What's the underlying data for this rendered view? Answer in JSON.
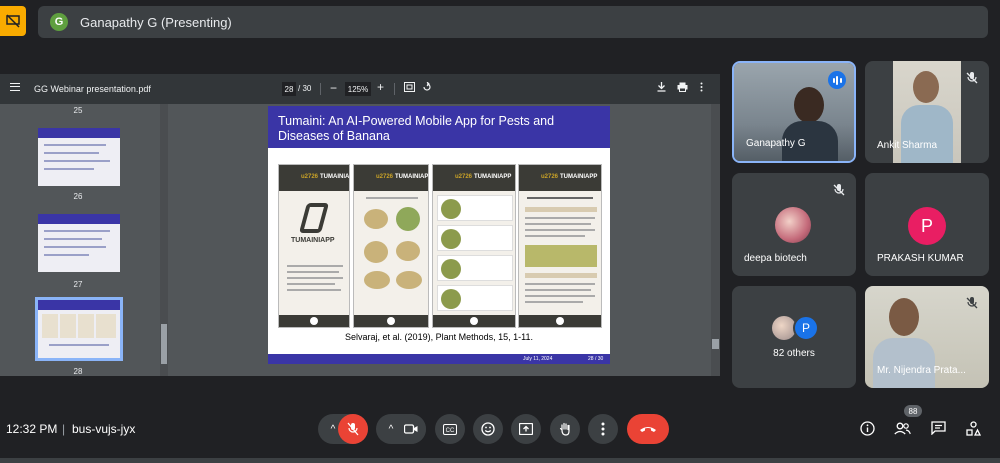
{
  "meeting": {
    "presenter_initial": "G",
    "presenter_label": "Ganapathy G (Presenting)",
    "time": "12:32 PM",
    "separator": "|",
    "code": "bus-vujs-jyx",
    "participant_count": "88"
  },
  "pdf": {
    "filename": "GG Webinar presentation.pdf",
    "current_page": "28",
    "total_pages": "/ 30",
    "zoom": "125%",
    "thumbnails": [
      "25",
      "26",
      "27",
      "28"
    ],
    "selected_thumbnail": "28"
  },
  "slide": {
    "title": "Tumaini: An AI-Powered Mobile App for Pests and Diseases of Banana",
    "citation": "Selvaraj, et al. (2019), Plant Methods, 15, 1-11.",
    "app_logo": "TUMAINIAPP",
    "footer_date": "July 11, 2024",
    "footer_page": "28 / 30"
  },
  "participants": [
    {
      "name": "Ganapathy G",
      "speaking": true,
      "muted": false
    },
    {
      "name": "Ankit Sharma",
      "muted": true
    },
    {
      "name": "deepa biotech",
      "muted": true
    },
    {
      "name": "PRAKASH KUMAR",
      "initial": "P",
      "muted": false
    },
    {
      "name": "82 others",
      "initial": "P"
    },
    {
      "name": "Mr. Nijendra Prata...",
      "muted": true
    }
  ],
  "colors": {
    "background": "#202124",
    "tile": "#3c4043",
    "accent": "#1a73e8",
    "end_call": "#ea4335",
    "slide_header": "#3a35a6",
    "present_badge": "#f9ab00",
    "avatar_p": "#e91e63"
  },
  "icons": {
    "present_badge": "screen-share-off-icon",
    "end_call": "call-end-icon",
    "mic": "mic-off-icon",
    "camera": "videocam-icon",
    "captions": "closed-caption-icon",
    "reactions": "emoji-icon",
    "present": "present-screen-icon",
    "hand": "raise-hand-icon",
    "more": "more-vertical-icon",
    "info": "info-icon",
    "people": "people-icon",
    "chat": "chat-icon",
    "activities": "activities-icon"
  }
}
